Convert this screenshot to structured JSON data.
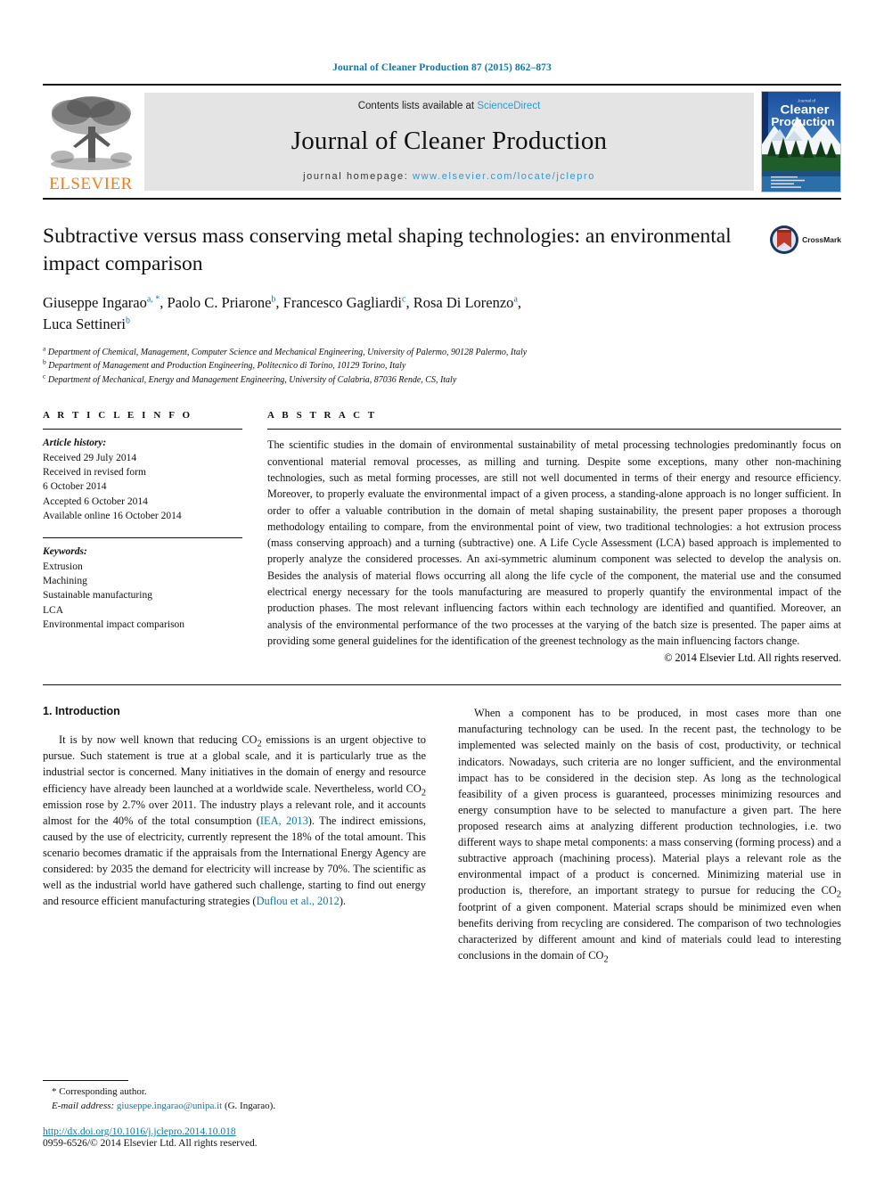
{
  "running_head": "Journal of Cleaner Production 87 (2015) 862–873",
  "masthead": {
    "contents_prefix": "Contents lists available at",
    "sciencedirect": "ScienceDirect",
    "journal_name": "Journal of Cleaner Production",
    "homepage_prefix": "journal homepage:",
    "homepage_url": "www.elsevier.com/locate/jclepro",
    "publisher": "ELSEVIER",
    "cover_title_small": "Journal of",
    "cover_title_line1": "Cleaner",
    "cover_title_line2": "Production"
  },
  "article": {
    "title": "Subtractive versus mass conserving metal shaping technologies: an environmental impact comparison",
    "crossmark_label": "CrossMark",
    "authors_line1_a": "Giuseppe Ingarao",
    "authors_line1_a_sup": "a, *",
    "authors_line1_b": "Paolo C. Priarone",
    "authors_line1_b_sup": "b",
    "authors_line1_c": "Francesco Gagliardi",
    "authors_line1_c_sup": "c",
    "authors_line1_d": "Rosa Di Lorenzo",
    "authors_line1_d_sup": "a",
    "authors_line2_e": "Luca Settineri",
    "authors_line2_e_sup": "b",
    "affiliations": [
      {
        "marker": "a",
        "text": "Department of Chemical, Management, Computer Science and Mechanical Engineering, University of Palermo, 90128 Palermo, Italy"
      },
      {
        "marker": "b",
        "text": "Department of Management and Production Engineering, Politecnico di Torino, 10129 Torino, Italy"
      },
      {
        "marker": "c",
        "text": "Department of Mechanical, Energy and Management Engineering, University of Calabria, 87036 Rende, CS, Italy"
      }
    ]
  },
  "article_info": {
    "heading": "A R T I C L E   I N F O",
    "history_label": "Article history:",
    "history": [
      "Received 29 July 2014",
      "Received in revised form",
      "6 October 2014",
      "Accepted 6 October 2014",
      "Available online 16 October 2014"
    ],
    "keywords_label": "Keywords:",
    "keywords": [
      "Extrusion",
      "Machining",
      "Sustainable manufacturing",
      "LCA",
      "Environmental impact comparison"
    ]
  },
  "abstract": {
    "heading": "A B S T R A C T",
    "text": "The scientific studies in the domain of environmental sustainability of metal processing technologies predominantly focus on conventional material removal processes, as milling and turning. Despite some exceptions, many other non-machining technologies, such as metal forming processes, are still not well documented in terms of their energy and resource efficiency. Moreover, to properly evaluate the environmental impact of a given process, a standing-alone approach is no longer sufficient. In order to offer a valuable contribution in the domain of metal shaping sustainability, the present paper proposes a thorough methodology entailing to compare, from the environmental point of view, two traditional technologies: a hot extrusion process (mass conserving approach) and a turning (subtractive) one. A Life Cycle Assessment (LCA) based approach is implemented to properly analyze the considered processes. An axi-symmetric aluminum component was selected to develop the analysis on. Besides the analysis of material flows occurring all along the life cycle of the component, the material use and the consumed electrical energy necessary for the tools manufacturing are measured to properly quantify the environmental impact of the production phases. The most relevant influencing factors within each technology are identified and quantified. Moreover, an analysis of the environmental performance of the two processes at the varying of the batch size is presented. The paper aims at providing some general guidelines for the identification of the greenest technology as the main influencing factors change.",
    "copyright": "© 2014 Elsevier Ltd. All rights reserved."
  },
  "body": {
    "section_heading": "1. Introduction",
    "left_paragraph_part1": "It is by now well known that reducing CO",
    "left_sub1": "2",
    "left_paragraph_part2": " emissions is an urgent objective to pursue. Such statement is true at a global scale, and it is particularly true as the industrial sector is concerned. Many initiatives in the domain of energy and resource efficiency have already been launched at a worldwide scale. Nevertheless, world CO",
    "left_sub2": "2",
    "left_paragraph_part3": " emission rose by 2.7% over 2011. The industry plays a relevant role, and it accounts almost for the 40% of the total consumption (",
    "left_citation1": "IEA, 2013",
    "left_paragraph_part4": "). The indirect emissions, caused by the use of electricity, currently represent the 18% of the total amount. This scenario becomes dramatic if the appraisals from the International Energy Agency are considered: by 2035 the demand for electricity will increase by 70%. The scientific as well as the industrial world have gathered such challenge, starting to find out energy and resource efficient manufacturing strategies (",
    "left_citation2": "Duflou et al., 2012",
    "left_paragraph_part5": ").",
    "right_paragraph_part1": "When a component has to be produced, in most cases more than one manufacturing technology can be used. In the recent past, the technology to be implemented was selected mainly on the basis of cost, productivity, or technical indicators. Nowadays, such criteria are no longer sufficient, and the environmental impact has to be considered in the decision step. As long as the technological feasibility of a given process is guaranteed, processes minimizing resources and energy consumption have to be selected to manufacture a given part. The here proposed research aims at analyzing different production technologies, i.e. two different ways to shape metal components: a mass conserving (forming process) and a subtractive approach (machining process). Material plays a relevant role as the environmental impact of a product is concerned. Minimizing material use in production is, therefore, an important strategy to pursue for reducing the CO",
    "right_sub1": "2",
    "right_paragraph_part2": " footprint of a given component. Material scraps should be minimized even when benefits deriving from recycling are considered. The comparison of two technologies characterized by different amount and kind of materials could lead to interesting conclusions in the domain of CO",
    "right_sub2": "2"
  },
  "footer": {
    "corresponding_author": "* Corresponding author.",
    "email_label": "E-mail address:",
    "email": "giuseppe.ingarao@unipa.it",
    "email_suffix": "(G. Ingarao).",
    "doi": "http://dx.doi.org/10.1016/j.jclepro.2014.10.018",
    "issn": "0959-6526/© 2014 Elsevier Ltd. All rights reserved."
  },
  "colors": {
    "link_blue": "#1274a8",
    "sciencedirect_blue": "#2f9ad0",
    "elsevier_orange": "#ef7d1a",
    "masthead_gray": "#e4e4e4"
  }
}
